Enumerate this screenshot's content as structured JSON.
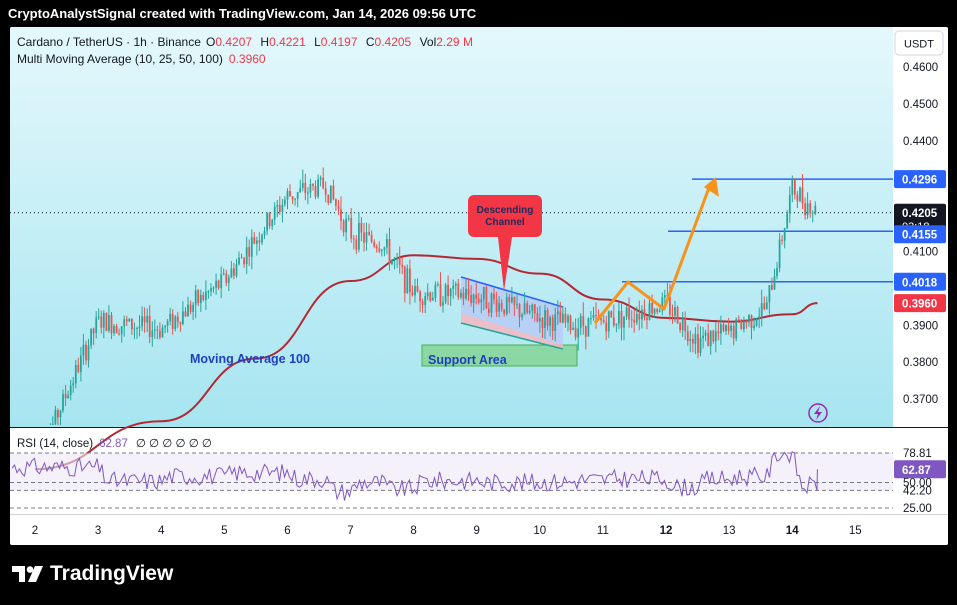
{
  "top_caption": "CryptoAnalystSignal created with TradingView.com, Jan 14, 2026 09:56 UTC",
  "header": {
    "symbol": "Cardano / TetherUS · 1h · Binance",
    "o_label": "O",
    "o": "0.4207",
    "h_label": "H",
    "h": "0.4221",
    "l_label": "L",
    "l": "0.4197",
    "c_label": "C",
    "c": "0.4205",
    "vol_label": "Vol",
    "vol": "2.29 M",
    "indicator_name": "Multi Moving Average (10, 25, 50, 100)",
    "indicator_value": "0.3960"
  },
  "currency_button": "USDT",
  "annotations": {
    "descending_channel": [
      "Descending",
      "Channel"
    ],
    "moving_average": "Moving Average 100",
    "support": "Support Area"
  },
  "price_tags": {
    "current": "0.4205",
    "countdown": "03:18",
    "r1": "0.4296",
    "r2": "0.4155",
    "r3": "0.4018",
    "ma": "0.3960",
    "hidden_under_tag": "0.4100"
  },
  "rsi": {
    "label": "RSI (14, close)",
    "value_text": "62.87",
    "placeholders": "∅ ∅ ∅ ∅ ∅ ∅",
    "tag_current": "62.87"
  },
  "footer_brand": "TradingView",
  "colors": {
    "up": "#26a69a",
    "down": "#ef5350",
    "ma": "#b22833",
    "levels": "#2962ff",
    "arrow": "#f7931a",
    "rsi": "#7e57c2",
    "bg_top": "#e1f7fc",
    "bg_bottom": "#a9e8f2",
    "tag_blue": "#2962ff",
    "tag_red": "#f23645",
    "tag_black": "#131722"
  },
  "chart_data": [
    {
      "type": "candlestick",
      "title": "Cardano / TetherUS · 1h · Binance",
      "ylim": [
        0.3625,
        0.4695
      ],
      "y_ticks": [
        "0.4600",
        "0.4500",
        "0.4400",
        "0.4296",
        "0.4205",
        "0.4155",
        "0.4018",
        "0.3960",
        "0.3900",
        "0.3800",
        "0.3700"
      ],
      "x_ticks": [
        "2",
        "3",
        "4",
        "5",
        "6",
        "7",
        "8",
        "9",
        "10",
        "11",
        "12",
        "13",
        "14",
        "15"
      ],
      "price_path_approx": [
        {
          "x": "2",
          "close": 0.352
        },
        {
          "x": "3",
          "close": 0.391
        },
        {
          "x": "4",
          "close": 0.389
        },
        {
          "x": "5",
          "close": 0.402
        },
        {
          "x": "6",
          "close": 0.425
        },
        {
          "x": "6.6",
          "close": 0.428
        },
        {
          "x": "7",
          "close": 0.415
        },
        {
          "x": "7.5",
          "close": 0.412
        },
        {
          "x": "8",
          "close": 0.399
        },
        {
          "x": "9",
          "close": 0.398
        },
        {
          "x": "10",
          "close": 0.392
        },
        {
          "x": "10.5",
          "close": 0.39
        },
        {
          "x": "11",
          "close": 0.391
        },
        {
          "x": "12",
          "close": 0.396
        },
        {
          "x": "12.5",
          "close": 0.386
        },
        {
          "x": "13",
          "close": 0.388
        },
        {
          "x": "13.6",
          "close": 0.395
        },
        {
          "x": "14",
          "close": 0.427
        },
        {
          "x": "14.4",
          "close": 0.4205
        }
      ],
      "moving_average_100": [
        {
          "x": "2",
          "y": 0.351
        },
        {
          "x": "4",
          "y": 0.364
        },
        {
          "x": "5.5",
          "y": 0.381
        },
        {
          "x": "7",
          "y": 0.402
        },
        {
          "x": "8",
          "y": 0.409
        },
        {
          "x": "9",
          "y": 0.408
        },
        {
          "x": "10",
          "y": 0.404
        },
        {
          "x": "11",
          "y": 0.397
        },
        {
          "x": "12",
          "y": 0.392
        },
        {
          "x": "13",
          "y": 0.391
        },
        {
          "x": "14",
          "y": 0.393
        },
        {
          "x": "14.4",
          "y": 0.396
        }
      ],
      "horizontal_levels": [
        0.4296,
        0.4155,
        0.4018
      ]
    },
    {
      "type": "line",
      "title": "RSI (14, close)",
      "ylim": [
        20,
        85
      ],
      "y_ticks": [
        "78.81",
        "62.87",
        "50.00",
        "42.20",
        "25.00"
      ],
      "last_value": 62.87
    }
  ]
}
